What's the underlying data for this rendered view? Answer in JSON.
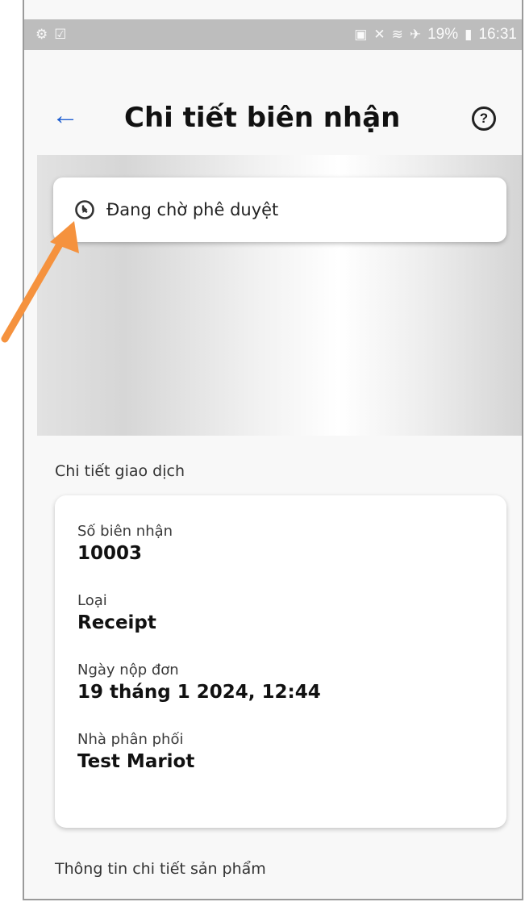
{
  "status_bar": {
    "left_icons": [
      "teams-icon",
      "message-icon"
    ],
    "battery": "19%",
    "time": "16:31"
  },
  "header": {
    "back_icon": "arrow-left-icon",
    "title": "Chi tiết biên nhận",
    "help_icon": "help-circle-icon"
  },
  "status": {
    "icon": "clock-icon",
    "text": "Đang chờ phê duyệt"
  },
  "sections": {
    "transaction_title": "Chi tiết giao dịch",
    "product_title": "Thông tin chi tiết sản phẩm"
  },
  "details": [
    {
      "label": "Số biên nhận",
      "value": "10003"
    },
    {
      "label": "Loại",
      "value": "Receipt"
    },
    {
      "label": "Ngày nộp đơn",
      "value": "19 tháng 1 2024, 12:44"
    },
    {
      "label": "Nhà phân phối",
      "value": "Test Mariot"
    }
  ],
  "colors": {
    "accent": "#1f5fd1",
    "annotation_arrow": "#f5923e"
  }
}
